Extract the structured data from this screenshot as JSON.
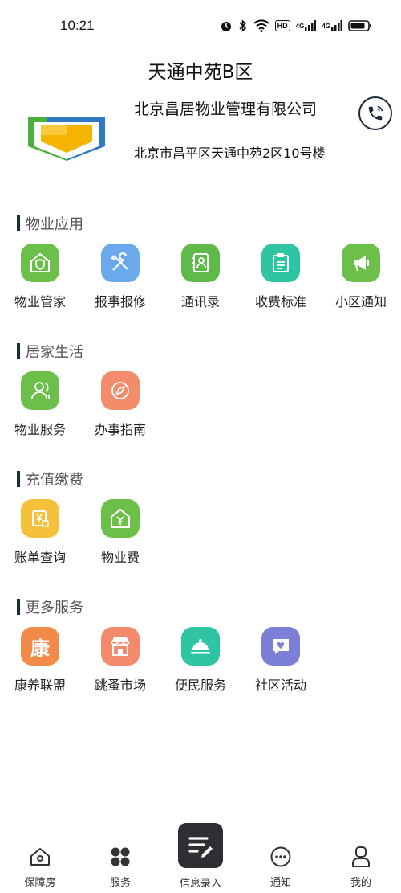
{
  "status_bar": {
    "time": "10:21",
    "icons": [
      "alarm-icon",
      "bluetooth-icon",
      "wifi-icon",
      "hd-icon",
      "signal-icon",
      "signal-icon",
      "battery-icon"
    ],
    "hd_label": "HD",
    "net1": "4G",
    "net2": "4G"
  },
  "header": {
    "title": "天通中苑B区",
    "company_name": "北京昌居物业管理有限公司",
    "company_address": "北京市昌平区天通中苑2区10号楼"
  },
  "sections": {
    "property": {
      "title": "物业应用",
      "items": [
        {
          "label": "物业管家",
          "icon": "house-shield-icon",
          "color": "#6cc04a"
        },
        {
          "label": "报事报修",
          "icon": "tools-icon",
          "color": "#6aa9ec"
        },
        {
          "label": "通讯录",
          "icon": "contacts-icon",
          "color": "#5fba4a"
        },
        {
          "label": "收费标准",
          "icon": "clipboard-icon",
          "color": "#2fc4a2"
        },
        {
          "label": "小区通知",
          "icon": "megaphone-icon",
          "color": "#6cc04a"
        }
      ]
    },
    "home": {
      "title": "居家生活",
      "items": [
        {
          "label": "物业服务",
          "icon": "service-people-icon",
          "color": "#6cc04a"
        },
        {
          "label": "办事指南",
          "icon": "compass-icon",
          "color": "#f28c6b"
        }
      ]
    },
    "pay": {
      "title": "充值缴费",
      "items": [
        {
          "label": "账单查询",
          "icon": "bill-icon",
          "color": "#f5c13a"
        },
        {
          "label": "物业费",
          "icon": "house-yen-icon",
          "color": "#6cc04a"
        }
      ]
    },
    "more": {
      "title": "更多服务",
      "items": [
        {
          "label": "康养联盟",
          "icon": "kang-icon",
          "color": "#f28a4a",
          "glyph": "康"
        },
        {
          "label": "跳蚤市场",
          "icon": "shop-icon",
          "color": "#f28a6b"
        },
        {
          "label": "便民服务",
          "icon": "cloche-icon",
          "color": "#2fc4a2"
        },
        {
          "label": "社区活动",
          "icon": "heart-chat-icon",
          "color": "#7b7fd6"
        }
      ]
    }
  },
  "tab_bar": {
    "items": [
      {
        "label": "保障房",
        "icon": "home-icon"
      },
      {
        "label": "服务",
        "icon": "grid-icon"
      },
      {
        "label": "信息录入",
        "icon": "edit-icon"
      },
      {
        "label": "通知",
        "icon": "chat-dots-icon"
      },
      {
        "label": "我的",
        "icon": "profile-icon"
      }
    ]
  }
}
